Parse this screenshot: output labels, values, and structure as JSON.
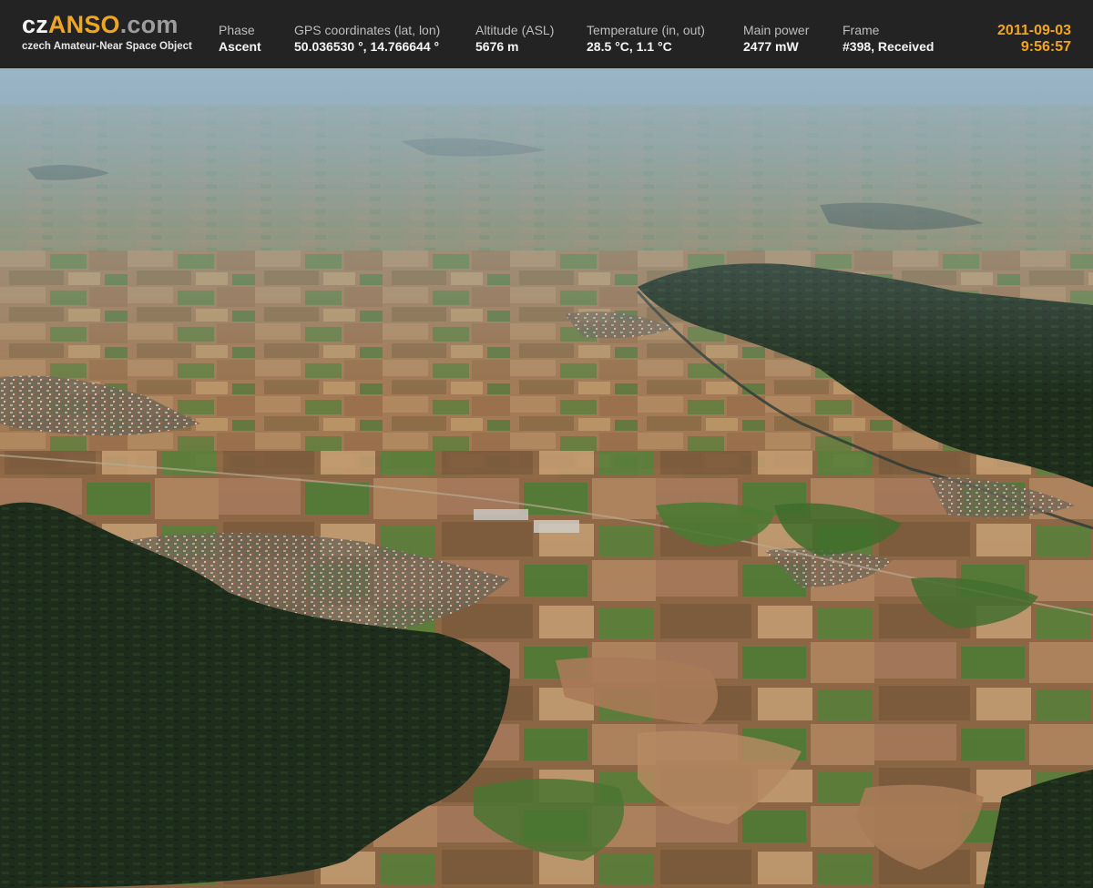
{
  "logo": {
    "part_cz": "cz",
    "part_anso": "ANSO",
    "part_com": ".com",
    "subtitle": "czech Amateur-Near Space Object"
  },
  "telemetry": {
    "phase": {
      "label": "Phase",
      "value": "Ascent"
    },
    "gps": {
      "label": "GPS coordinates (lat, lon)",
      "value": "50.036530 °, 14.766644 °"
    },
    "altitude": {
      "label": "Altitude (ASL)",
      "value": "5676 m"
    },
    "temperature": {
      "label": "Temperature (in, out)",
      "value": "28.5 °C, 1.1 °C"
    },
    "power": {
      "label": "Main power",
      "value": "2477 mW"
    },
    "frame": {
      "label": "Frame",
      "value": "#398, Received"
    }
  },
  "datetime": {
    "date": "2011-09-03",
    "time": "9:56:57"
  },
  "colors": {
    "accent": "#f0a623",
    "header_bg": "#232323",
    "sky_haze": "#7fa3b8",
    "forest": "#1f2f1c",
    "field_brown": "#9c6f4b",
    "field_green": "#4f7a35"
  },
  "photo": {
    "subject": "aerial-landscape"
  }
}
